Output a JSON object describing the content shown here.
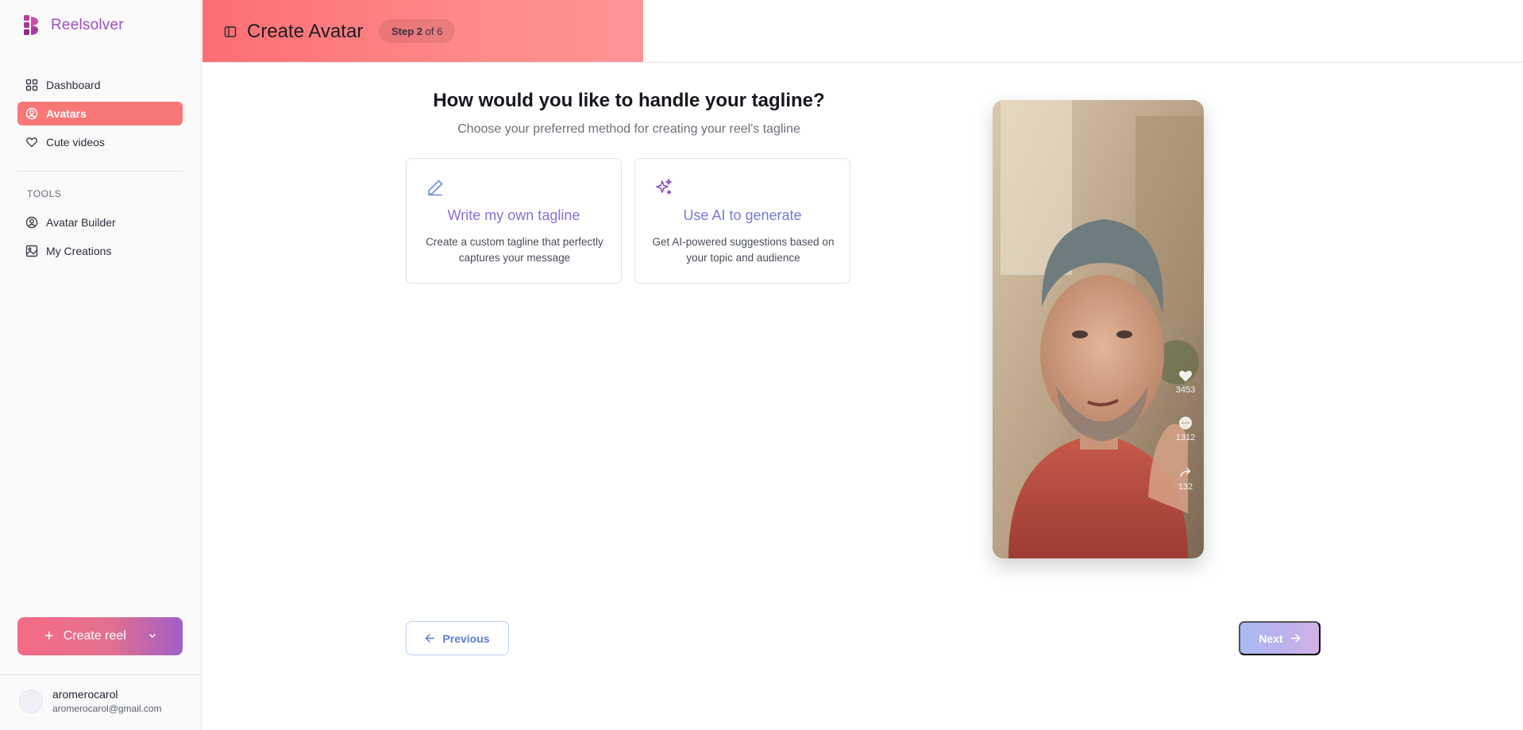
{
  "app": {
    "name": "Reelsolver"
  },
  "sidebar": {
    "nav": [
      {
        "label": "Dashboard",
        "icon": "dashboard-icon",
        "active": false
      },
      {
        "label": "Avatars",
        "icon": "user-circle-icon",
        "active": true
      },
      {
        "label": "Cute videos",
        "icon": "heart-icon",
        "active": false
      }
    ],
    "tools_title": "TOOLS",
    "tools": [
      {
        "label": "Avatar Builder",
        "icon": "user-circle-icon"
      },
      {
        "label": "My Creations",
        "icon": "image-icon"
      }
    ],
    "create_button": "Create reel",
    "user": {
      "name": "aromerocarol",
      "email": "aromerocarol@gmail.com"
    }
  },
  "header": {
    "title": "Create Avatar",
    "step_prefix": "Step",
    "step_current": "2",
    "step_of": "of 6"
  },
  "main": {
    "question": "How would you like to handle your tagline?",
    "subtitle": "Choose your preferred method for creating your reel's tagline",
    "options": [
      {
        "title": "Write my own tagline",
        "description": "Create a custom tagline that perfectly captures your message",
        "icon": "pencil-icon"
      },
      {
        "title": "Use AI to generate",
        "description": "Get AI-powered suggestions based on your topic and audience",
        "icon": "sparkles-icon"
      }
    ]
  },
  "preview": {
    "likes": "3453",
    "comments": "1312",
    "shares": "132"
  },
  "footer": {
    "previous": "Previous",
    "next": "Next"
  },
  "colors": {
    "accent": "#f87878",
    "brand": "#a24cc0",
    "option_title": "#8a70d6",
    "prev_border": "#bcd0f0"
  }
}
